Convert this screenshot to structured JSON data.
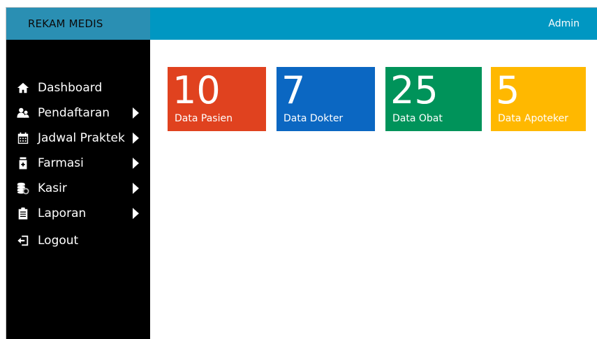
{
  "header": {
    "brand": "REKAM MEDIS",
    "user": "Admin"
  },
  "sidebar": {
    "items": [
      {
        "label": "Dashboard",
        "icon": "home-icon",
        "submenu": false
      },
      {
        "label": "Pendaftaran",
        "icon": "users-icon",
        "submenu": true
      },
      {
        "label": "Jadwal Praktek",
        "icon": "calendar-icon",
        "submenu": true
      },
      {
        "label": "Farmasi",
        "icon": "medicine-bottle-icon",
        "submenu": true
      },
      {
        "label": "Kasir",
        "icon": "coins-icon",
        "submenu": true
      },
      {
        "label": "Laporan",
        "icon": "clipboard-icon",
        "submenu": true
      },
      {
        "label": "Logout",
        "icon": "logout-icon",
        "submenu": false
      }
    ]
  },
  "cards": [
    {
      "value": "10",
      "label": "Data Pasien",
      "color": "#e0421f"
    },
    {
      "value": "7",
      "label": "Data Dokter",
      "color": "#0b67c2"
    },
    {
      "value": "25",
      "label": "Data Obat",
      "color": "#00935a"
    },
    {
      "value": "5",
      "label": "Data Apoteker",
      "color": "#ffb800"
    }
  ],
  "colors": {
    "topbar": "#0097c2",
    "brand_bg": "#2a8fb3",
    "sidebar": "#000000"
  }
}
